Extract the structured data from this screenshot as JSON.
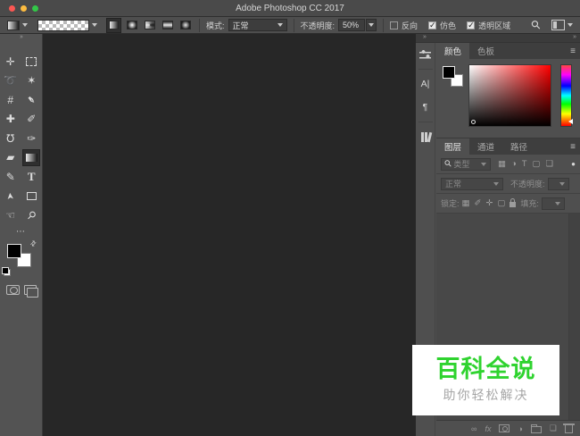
{
  "titlebar": {
    "title": "Adobe Photoshop CC 2017"
  },
  "options": {
    "mode_label": "模式:",
    "mode_value": "正常",
    "opacity_label": "不透明度:",
    "opacity_value": "50%",
    "reverse_label": "反向",
    "dither_label": "仿色",
    "transparency_label": "透明区域"
  },
  "color_panel": {
    "tab_color": "颜色",
    "tab_swatches": "色板"
  },
  "layers_panel": {
    "tab_layers": "图层",
    "tab_channels": "通道",
    "tab_paths": "路径",
    "filter_kind": "类型",
    "blend_mode": "正常",
    "opacity_label": "不透明度:",
    "lock_label": "锁定:",
    "fill_label": "填充:"
  },
  "watermark": {
    "title": "百科全说",
    "subtitle": "助你轻松解决",
    "accent_color": "#2fd32f"
  },
  "colors": {
    "ui_chrome": "#4f4f4f",
    "canvas": "#272727",
    "titlebar": "#4a4a4a"
  },
  "icons": {
    "collapse_left": "«",
    "collapse_right": "»",
    "collapse_toolbar": "››",
    "menu": "≡",
    "search": "⚲",
    "move": "✛",
    "lasso": "➰",
    "magic_wand": "✶",
    "crop": "#",
    "eyedropper": "✒",
    "healing": "✚",
    "brush": "✐",
    "stamp": "℧",
    "history_brush": "✑",
    "eraser": "▰",
    "pen": "✎",
    "type": "T",
    "path_select": "➤",
    "hand": "☜",
    "zoom": "⚲",
    "ellipsis": "⋯",
    "swap": "⇄",
    "char_panel": "A|",
    "paragraph_panel": "¶",
    "filter_image": "▦",
    "filter_adjust": "◑",
    "filter_type": "T",
    "filter_shape": "▢",
    "filter_smart": "❏",
    "filter_toggle": "●",
    "lock_transparent": "▦",
    "lock_paint": "✐",
    "lock_move": "✛",
    "lock_artboard": "▢",
    "link": "∞",
    "fx": "fx",
    "adjust_circle": "◑",
    "new_layer": "❏"
  }
}
